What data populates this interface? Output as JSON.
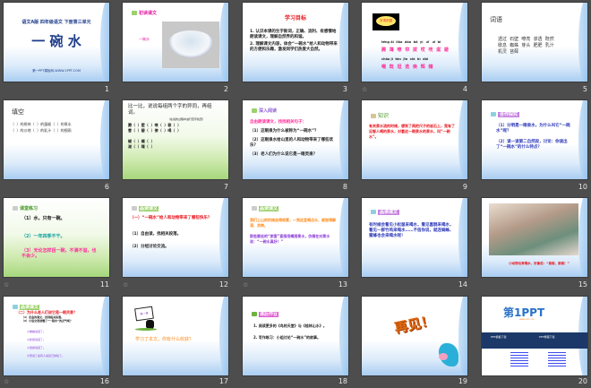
{
  "slides": [
    {
      "num": "1",
      "subtitle": "语文A版 四年级语文 下册第三单元",
      "title": "一 碗 水",
      "footer": "第一PPT模板网-WWW.1PPT.COM"
    },
    {
      "num": "2",
      "header": "初读课文",
      "caption": "一碗水"
    },
    {
      "num": "3",
      "title": "学习目标",
      "lines": [
        "1. 认识本课的生字新词，正确、流利、有感情地朗读课文，理解自然界的和谐。",
        "2. 理解课文内容，体会“一碗水”给人和动物带来的方便和乐趣，激发同学们热爱大自然。"
      ]
    },
    {
      "num": "4",
      "badge": "字词乐园",
      "pinyin1": "téng ǎi  liǎo  dào  bō  yì   zī   zǐ  bì",
      "chars1": "腾 蔼 嘹 帘 拨 哎 吱 滋 避",
      "pinyin2": "chǎo jì  tǎn  jīn  xià  bì  dài",
      "chars2": "嘲 既 坦 迭 唤 辉 幢"
    },
    {
      "num": "5",
      "title": "词语",
      "words": [
        "透过  石壁  嘹亮  渗透  既然",
        "歇息  蜘蛛  芽头  肥肥  乳汁",
        "机灵  苔藓"
      ]
    },
    {
      "num": "6",
      "title": "填空",
      "lines": [
        "（  ）的树林（  ）的蛋糕（  ）的泉水",
        "（  ）的沙地（  ）的乳汁（  ）的细雨"
      ]
    },
    {
      "num": "7",
      "title": "比一比，说说每组两个字的异同，再组词。",
      "note": "（在说的过程中进行查字检查）",
      "lines": [
        "腾（  ）壁（  ）嘹（  ）歇（  ）",
        "誊（  ）碧（  ）僚（  ）喝（  ）",
        "",
        "蝴（  ）蝶（  ）",
        "湖（  ）喋（  ）"
      ]
    },
    {
      "num": "8",
      "header": "深入阅读",
      "intro": "自由朗读课文，找找相关句子：",
      "lines": [
        "（1）这眼泉为什么被称为“一碗水”？",
        "（2）这眼泉水给山里的人和动物带来了哪些欢乐？",
        "（3）老人们为什么说它是一眼灵泉？"
      ]
    },
    {
      "num": "9",
      "header": "知识",
      "body": "有关泉水流的时候，想到了两把尺子的岩石上，竟有了足够人喝的泉水，对着这一眼泉水的泉水，叫“一碗水”。"
    },
    {
      "num": "10",
      "header": "合作探究",
      "lines": [
        "（1）分明是一眼泉水，为什么叫它“一碗水”呢？",
        "（2）读一读第二自然段，讨论：你读出了“一碗水”的什么特点？"
      ]
    },
    {
      "num": "11",
      "header": "课堂练习",
      "lines": [
        "（1）水，只有一碗。",
        "（2）一年四季不干。",
        "（3）无论怎样舀一碗，不满不溢，也不会少。"
      ]
    },
    {
      "num": "12",
      "header": "品读课文",
      "lines": [
        "（一）“一碗水”给人和动物带来了哪些快乐？",
        "（1）自由读，找相关段落。",
        "（2）分组讨论交流。"
      ]
    },
    {
      "num": "13",
      "header": "品读课文",
      "lines": [
        "我们上山的时候走得很累，一到这里喝点水，就觉得解渴、凉爽。",
        "那些要走的“旅客”直接用嘴接泉水，仿佛在对泉水说：“一碗水真好！”"
      ]
    },
    {
      "num": "14",
      "header": "品读课文",
      "body": "有时候会看见小松鼠来喝水，看见喜鹊来喝水，看见一群竹鸡来喝水……不信你说，就连蜘蛛、蜜蜂也会来喝水呢！"
    },
    {
      "num": "15",
      "caption": "小动物也来喝水，好像说：“谢谢，谢谢！”"
    },
    {
      "num": "16",
      "header": "品读课文",
      "question": "（二）为什么老人们说它是一眼灵泉？",
      "lines": [
        "（1）走金的课文，找到相关段落。",
        "（2）小组交流读懂了“一碗水”的灵气呢？",
        "小蜘蛛说话了。",
        "小松鼠说话了。",
        "小蜜蜂说话了。",
        "大家说了会有人说自己的哈了。"
      ]
    },
    {
      "num": "17",
      "sign": "第一课",
      "body": "学习了本文，你有什么收获？"
    },
    {
      "num": "18",
      "header": "课后作业",
      "lines": [
        "1. 阅读更多的《鸟的天堂》与《桂林山水》。",
        "2. 写作练习：小组讨论“一碗水”的故事。"
      ]
    },
    {
      "num": "19",
      "title": "再见！"
    },
    {
      "num": "20",
      "logo_main": "第1PPT",
      "logo_sub": "WWW.1PPT.COM",
      "bar_left": "PPT模板下载",
      "bar_right": "PPT教程下载"
    }
  ],
  "colors": {
    "navy": "#1f3e8c",
    "red": "#e8141b",
    "pink": "#ff2d9a",
    "blue": "#2c38b8",
    "orange": "#ff8b1a"
  }
}
